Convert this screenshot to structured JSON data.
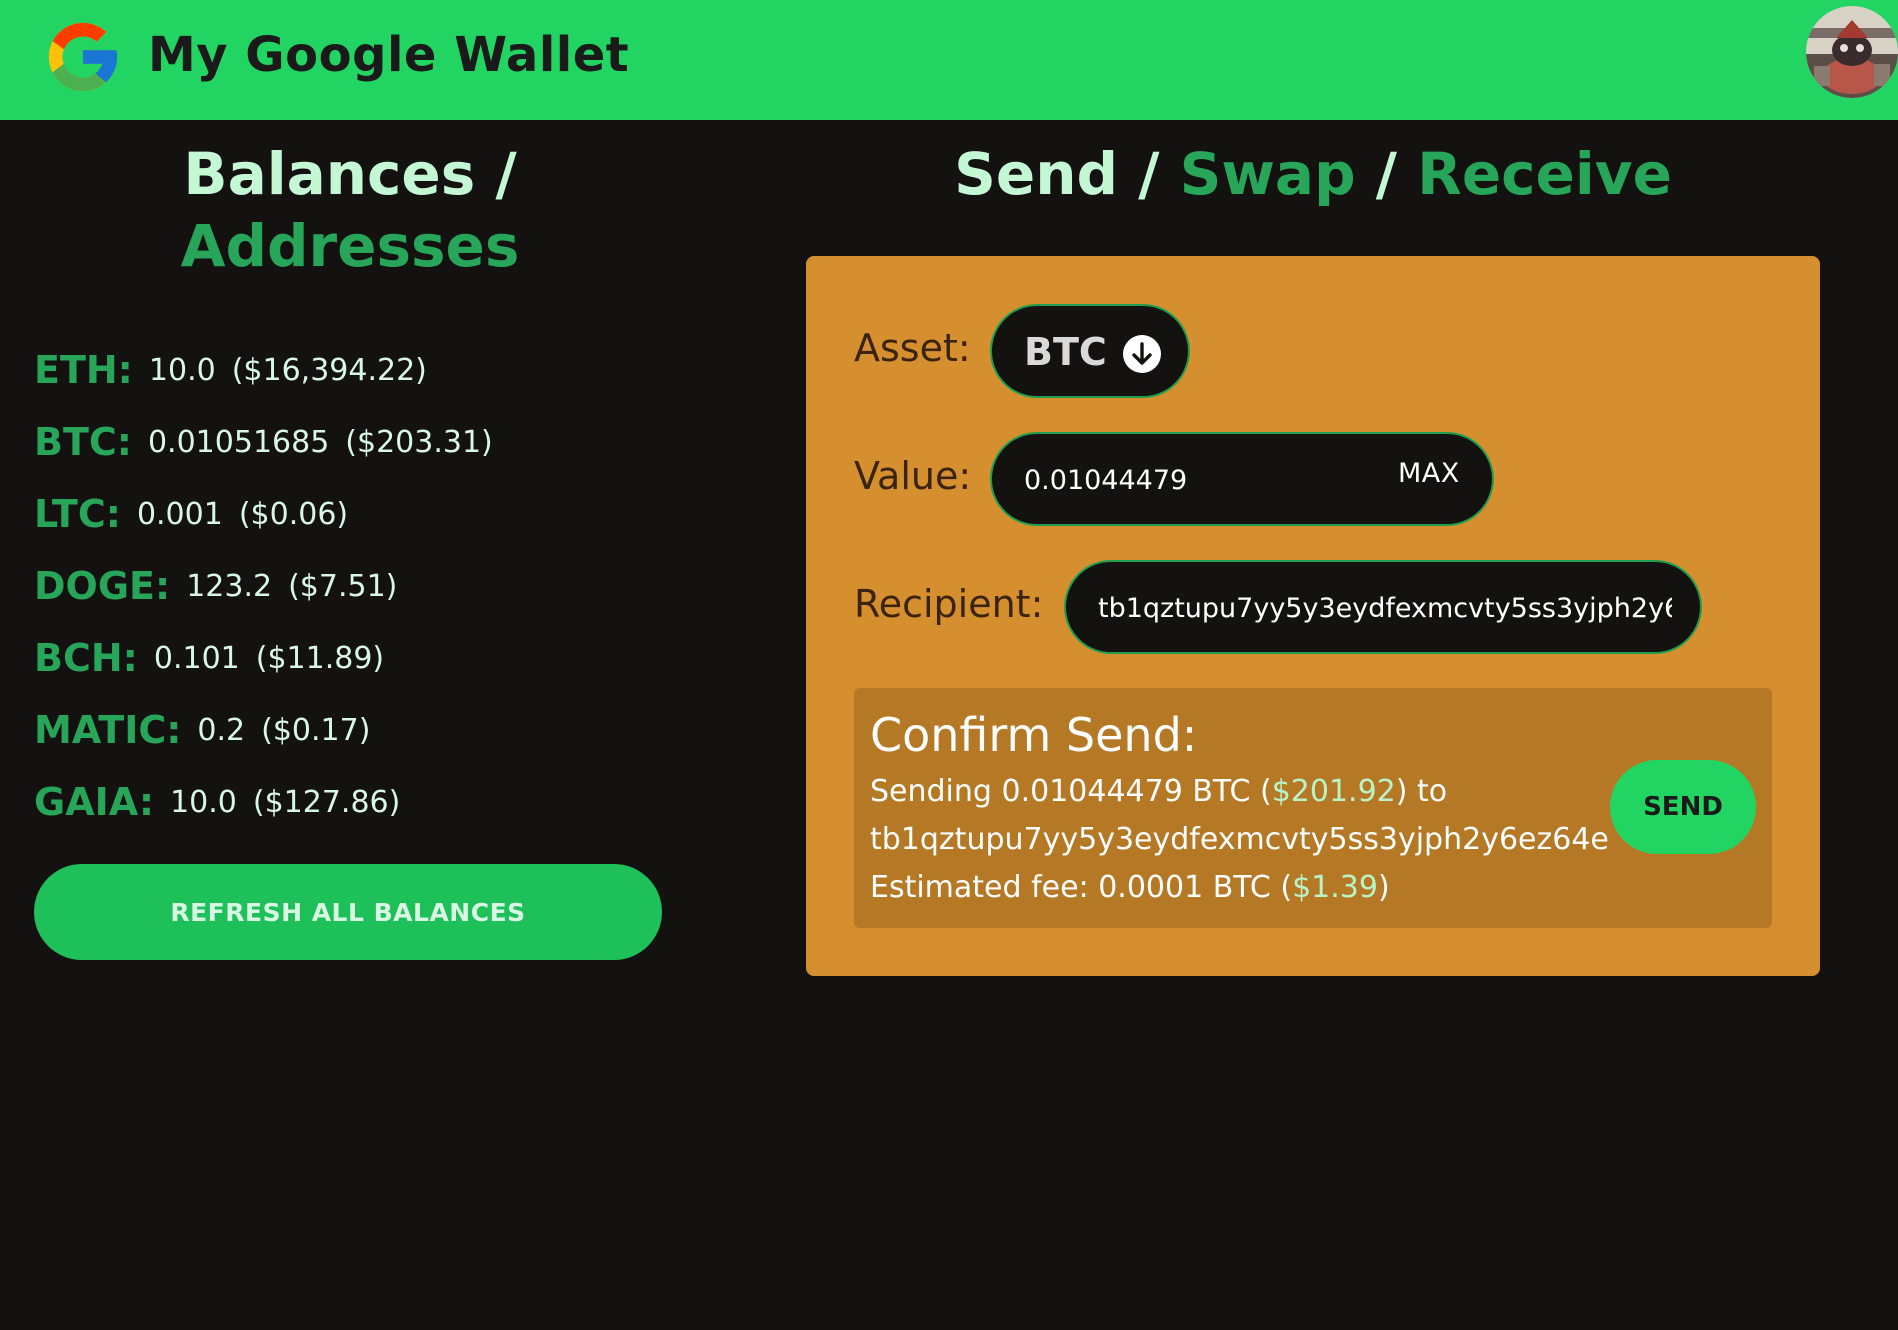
{
  "header": {
    "app_title": "My Google Wallet"
  },
  "balances_heading": {
    "part1": "Balances /",
    "part2": "Addresses"
  },
  "balances": [
    {
      "symbol": "ETH:",
      "amount": "10.0",
      "usd": "($16,394.22)"
    },
    {
      "symbol": "BTC:",
      "amount": "0.01051685",
      "usd": "($203.31)"
    },
    {
      "symbol": "LTC:",
      "amount": "0.001",
      "usd": "($0.06)"
    },
    {
      "symbol": "DOGE:",
      "amount": "123.2",
      "usd": "($7.51)"
    },
    {
      "symbol": "BCH:",
      "amount": "0.101",
      "usd": "($11.89)"
    },
    {
      "symbol": "MATIC:",
      "amount": "0.2",
      "usd": "($0.17)"
    },
    {
      "symbol": "GAIA:",
      "amount": "10.0",
      "usd": "($127.86)"
    }
  ],
  "refresh_button": "REFRESH ALL BALANCES",
  "action_heading": {
    "send": "Send",
    "sep1": " / ",
    "swap": "Swap",
    "sep2": " / ",
    "receive": "Receive"
  },
  "form": {
    "asset_label": "Asset:",
    "asset_value": "BTC",
    "value_label": "Value:",
    "value": "0.01044479",
    "max_label": "MAX",
    "recipient_label": "Recipient:",
    "recipient": "tb1qztupu7yy5y3eydfexmcvty5ss3yjph2y6ez64e"
  },
  "confirm": {
    "title": "Confirm Send:",
    "sending_prefix": "Sending 0.01044479 BTC (",
    "sending_usd": "$201.92",
    "sending_suffix": ") to",
    "recipient": "tb1qztupu7yy5y3eydfexmcvty5ss3yjph2y6ez64e",
    "fee_prefix": "Estimated fee: 0.0001 BTC (",
    "fee_usd": "$1.39",
    "fee_suffix": ")",
    "send_button": "SEND"
  },
  "colors": {
    "header": "#22d563",
    "background": "#141111",
    "accent_green": "#27a65a",
    "panel": "#d68f2f",
    "confirm_box": "#b57824"
  }
}
